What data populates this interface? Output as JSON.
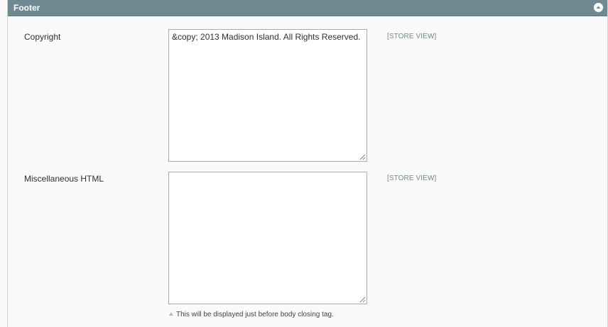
{
  "section": {
    "title": "Footer",
    "collapse_icon": "chevron-up-circle-icon"
  },
  "fields": [
    {
      "label": "Copyright",
      "value": "&copy; 2013 Madison Island. All Rights Reserved.",
      "scope": "[STORE VIEW]"
    },
    {
      "label": "Miscellaneous HTML",
      "value": "",
      "scope": "[STORE VIEW]",
      "note": "This will be displayed just before body closing tag."
    }
  ],
  "colors": {
    "header_bg": "#6f8992",
    "scope_text": "#6f8992",
    "page_bg": "#fafafa"
  }
}
